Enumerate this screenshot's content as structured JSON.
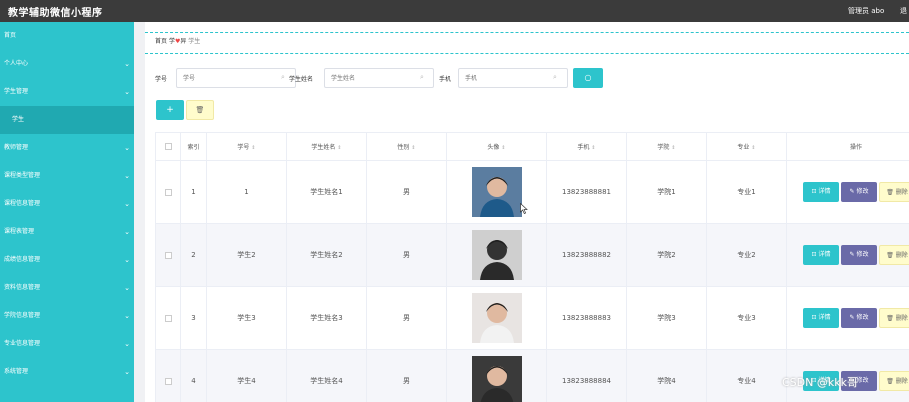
{
  "app": {
    "title": "教学辅助微信小程序",
    "admin_label": "管理员 abo",
    "admin_more": "退"
  },
  "sidebar": {
    "items": [
      {
        "label": "首页",
        "chevron": false,
        "sub": false
      },
      {
        "label": "个人中心",
        "chevron": true,
        "sub": false
      },
      {
        "label": "学生管理",
        "chevron": true,
        "sub": false
      },
      {
        "label": "学生",
        "chevron": false,
        "sub": true
      },
      {
        "label": "教师管理",
        "chevron": true,
        "sub": false
      },
      {
        "label": "课程类型管理",
        "chevron": true,
        "sub": false
      },
      {
        "label": "课程信息管理",
        "chevron": true,
        "sub": false
      },
      {
        "label": "课程表管理",
        "chevron": true,
        "sub": false
      },
      {
        "label": "成绩信息管理",
        "chevron": true,
        "sub": false
      },
      {
        "label": "资料信息管理",
        "chevron": true,
        "sub": false
      },
      {
        "label": "学院信息管理",
        "chevron": true,
        "sub": false
      },
      {
        "label": "专业信息管理",
        "chevron": true,
        "sub": false
      },
      {
        "label": "系统管理",
        "chevron": true,
        "sub": false
      }
    ]
  },
  "breadcrumb": {
    "home": "首页",
    "middle": "学",
    "current": "学生"
  },
  "search": {
    "student_no_label": "学号",
    "student_no_placeholder": "学号",
    "student_name_label": "学生姓名",
    "student_name_placeholder": "学生姓名",
    "phone_label": "手机",
    "phone_placeholder": "手机",
    "search_icon": "search-icon"
  },
  "toolbar": {
    "add_label": "+",
    "delete_label": "🗑"
  },
  "table": {
    "headers": [
      "",
      "索引",
      "学号",
      "学生姓名",
      "性别",
      "头像",
      "手机",
      "学院",
      "专业",
      "操作"
    ],
    "sortable": [
      false,
      false,
      true,
      true,
      true,
      true,
      true,
      true,
      true,
      false
    ],
    "rows": [
      {
        "index": "1",
        "student_no": "1",
        "name": "学生姓名1",
        "gender": "男",
        "phone": "13823888881",
        "college": "学院1",
        "major": "专业1",
        "avatar_tone": "#5b7da0"
      },
      {
        "index": "2",
        "student_no": "学生2",
        "name": "学生姓名2",
        "gender": "男",
        "phone": "13823888882",
        "college": "学院2",
        "major": "专业2",
        "avatar_tone": "#cfcfcf"
      },
      {
        "index": "3",
        "student_no": "学生3",
        "name": "学生姓名3",
        "gender": "男",
        "phone": "13823888883",
        "college": "学院3",
        "major": "专业3",
        "avatar_tone": "#e8e4e2"
      },
      {
        "index": "4",
        "student_no": "学生4",
        "name": "学生姓名4",
        "gender": "男",
        "phone": "13823888884",
        "college": "学院4",
        "major": "专业4",
        "avatar_tone": "#3a3a3a"
      }
    ],
    "ops": {
      "detail": "详情",
      "edit": "修改",
      "remove": "删除"
    }
  },
  "watermark": "CSDN @kkk哥",
  "colors": {
    "accent": "#2dc4cc",
    "topbar": "#3b3b3b",
    "edit": "#6a6aa8",
    "delete_bg": "#fffccc"
  }
}
